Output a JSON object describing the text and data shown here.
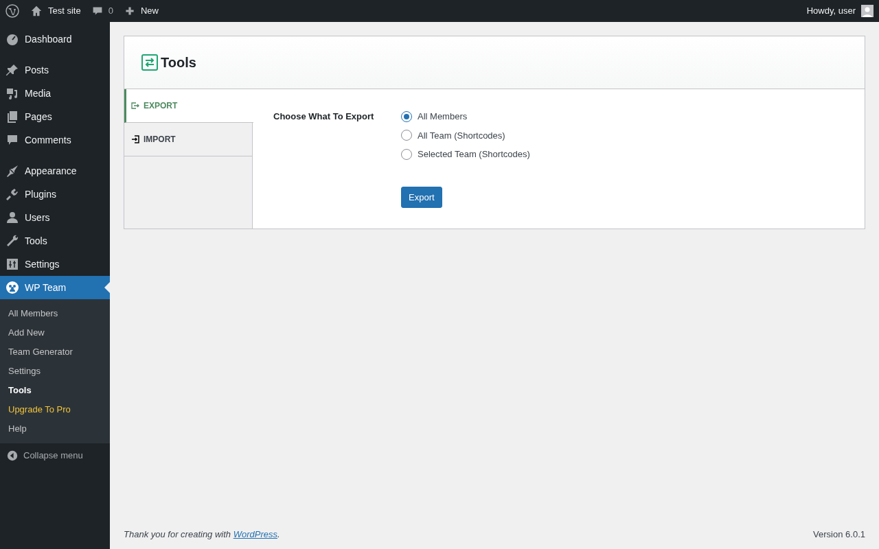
{
  "admin_bar": {
    "site": "Test site",
    "comments": "0",
    "new": "New",
    "greeting": "Howdy, user"
  },
  "menu_groups": [
    [
      {
        "label": "Dashboard",
        "selected": false
      }
    ],
    [
      {
        "label": "Posts",
        "selected": false
      },
      {
        "label": "Media",
        "selected": false
      },
      {
        "label": "Pages",
        "selected": false
      },
      {
        "label": "Comments",
        "selected": false
      }
    ],
    [
      {
        "label": "Appearance",
        "selected": false
      },
      {
        "label": "Plugins",
        "selected": false
      },
      {
        "label": "Users",
        "selected": false
      },
      {
        "label": "Tools",
        "selected": false
      },
      {
        "label": "Settings",
        "selected": false
      },
      {
        "label": "WP Team",
        "selected": true
      }
    ]
  ],
  "submenu": [
    {
      "label": "All Members",
      "selected": false,
      "kind": "link"
    },
    {
      "label": "Add New",
      "selected": false,
      "kind": "link"
    },
    {
      "label": "Team Generator",
      "selected": false,
      "kind": "link"
    },
    {
      "label": "Settings",
      "selected": false,
      "kind": "link"
    },
    {
      "label": "Tools",
      "selected": true,
      "kind": "link"
    },
    {
      "label": "Upgrade To Pro",
      "selected": false,
      "kind": "upgrade"
    },
    {
      "label": "Help",
      "selected": false,
      "kind": "link"
    }
  ],
  "collapse": "Collapse menu",
  "page_title": "Tools",
  "tabs": [
    {
      "label": "EXPORT",
      "selected": true
    },
    {
      "label": "IMPORT",
      "selected": false
    }
  ],
  "export_label": "Choose What To Export",
  "options": [
    {
      "label": "All Members",
      "selected": true
    },
    {
      "label": "All Team (Shortcodes)",
      "selected": false
    },
    {
      "label": "Selected Team (Shortcodes)",
      "selected": false
    }
  ],
  "button": "Export",
  "footer": {
    "text": "Thank you for creating with ",
    "link": "WordPress",
    "after": ".",
    "version": "Version 6.0.1"
  }
}
